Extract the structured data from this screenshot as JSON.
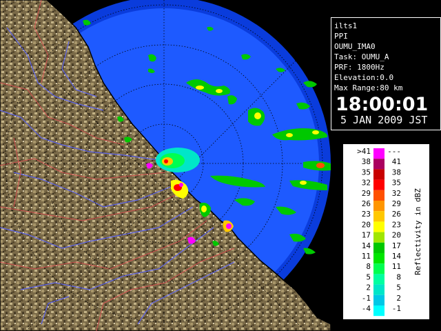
{
  "info": {
    "lines": [
      "ilts1",
      "PPI",
      "OUMU_IMA0",
      "Task: OUMU_A",
      "PRF: 1800Hz",
      "Elevation:0.0",
      "Max Range:80 km"
    ],
    "time": "18:00:01",
    "date": "5 JAN 2009 JST"
  },
  "legend": {
    "title": "Reflectivity in dBZ",
    "rows": [
      {
        "low": ">41",
        "high": "---",
        "color": "#ff00ff"
      },
      {
        "low": "38",
        "high": "41",
        "color": "#aa0060"
      },
      {
        "low": "35",
        "high": "38",
        "color": "#c80000"
      },
      {
        "low": "32",
        "high": "35",
        "color": "#ff0000"
      },
      {
        "low": "29",
        "high": "32",
        "color": "#ff5000"
      },
      {
        "low": "26",
        "high": "29",
        "color": "#ff9600"
      },
      {
        "low": "23",
        "high": "26",
        "color": "#ffc800"
      },
      {
        "low": "20",
        "high": "23",
        "color": "#ffff00"
      },
      {
        "low": "17",
        "high": "20",
        "color": "#a0e600"
      },
      {
        "low": "14",
        "high": "17",
        "color": "#00c800"
      },
      {
        "low": "11",
        "high": "14",
        "color": "#00e600"
      },
      {
        "low": "8",
        "high": "11",
        "color": "#00ff50"
      },
      {
        "low": "5",
        "high": "8",
        "color": "#00ffa0"
      },
      {
        "low": "2",
        "high": "5",
        "color": "#00e6c8"
      },
      {
        "low": "-1",
        "high": "2",
        "color": "#00c8e6"
      },
      {
        "low": "-4",
        "high": "-1",
        "color": "#00ffff"
      }
    ]
  },
  "colors": {
    "sea": "#1e5aff",
    "sea_outer": "#0a3cdc",
    "land": "#7a6a48",
    "coast": "#000000",
    "rivers": "#5a64ff",
    "boundaries": "#d25050",
    "range_rings": "#000000"
  }
}
